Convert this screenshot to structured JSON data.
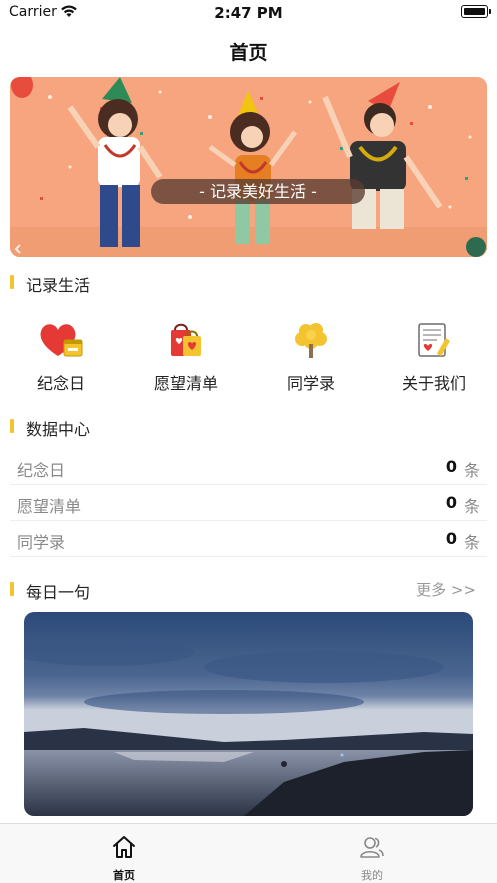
{
  "status_bar": {
    "carrier": "Carrier",
    "time": "2:47 PM",
    "wifi_icon": "wifi-icon",
    "battery_icon": "battery-icon"
  },
  "nav": {
    "title": "首页"
  },
  "banner": {
    "caption": "- 记录美好生活 -"
  },
  "section_life": {
    "title": "记录生活"
  },
  "shortcuts": [
    {
      "label": "纪念日",
      "icon": "heart-calendar-icon"
    },
    {
      "label": "愿望清单",
      "icon": "shopping-bags-icon"
    },
    {
      "label": "同学录",
      "icon": "tree-icon"
    },
    {
      "label": "关于我们",
      "icon": "notepad-icon"
    }
  ],
  "section_data": {
    "title": "数据中心"
  },
  "stats": [
    {
      "name": "纪念日",
      "value": "0",
      "unit": "条"
    },
    {
      "name": "愿望清单",
      "value": "0",
      "unit": "条"
    },
    {
      "name": "同学录",
      "value": "0",
      "unit": "条"
    }
  ],
  "section_daily": {
    "title": "每日一句",
    "more": "更多 >>"
  },
  "tabbar": {
    "items": [
      {
        "label": "首页",
        "icon": "home-icon",
        "active": true
      },
      {
        "label": "我的",
        "icon": "user-icon",
        "active": false
      }
    ]
  },
  "colors": {
    "accent": "#f4c430",
    "banner_bg": "#f6a57f",
    "text": "#222222",
    "muted": "#888888"
  }
}
